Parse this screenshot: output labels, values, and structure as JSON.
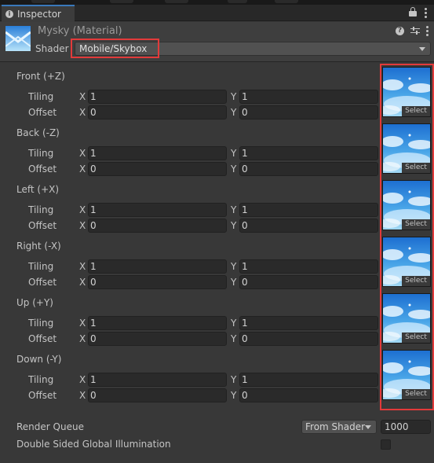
{
  "tab": {
    "label": "Inspector"
  },
  "material": {
    "title": "Mysky (Material)",
    "shader_label": "Shader",
    "shader_value": "Mobile/Skybox"
  },
  "labels": {
    "tiling": "Tiling",
    "offset": "Offset",
    "x": "X",
    "y": "Y",
    "select": "Select"
  },
  "slots": [
    {
      "title": "Front (+Z)",
      "tiling_x": "1",
      "tiling_y": "1",
      "offset_x": "0",
      "offset_y": "0"
    },
    {
      "title": "Back (-Z)",
      "tiling_x": "1",
      "tiling_y": "1",
      "offset_x": "0",
      "offset_y": "0"
    },
    {
      "title": "Left (+X)",
      "tiling_x": "1",
      "tiling_y": "1",
      "offset_x": "0",
      "offset_y": "0"
    },
    {
      "title": "Right (-X)",
      "tiling_x": "1",
      "tiling_y": "1",
      "offset_x": "0",
      "offset_y": "0"
    },
    {
      "title": "Up (+Y)",
      "tiling_x": "1",
      "tiling_y": "1",
      "offset_x": "0",
      "offset_y": "0"
    },
    {
      "title": "Down (-Y)",
      "tiling_x": "1",
      "tiling_y": "1",
      "offset_x": "0",
      "offset_y": "0"
    }
  ],
  "render_queue": {
    "label": "Render Queue",
    "mode": "From Shader",
    "value": "1000"
  },
  "dsgi": {
    "label": "Double Sided Global Illumination",
    "checked": false
  },
  "colors": {
    "accent_tab": "#3a79bb",
    "highlight": "#e23a3a",
    "sky_top": "#1d6fd1",
    "sky_bottom": "#a9dcf5"
  },
  "icons": [
    "info-icon",
    "lock-icon",
    "kebab-menu-icon",
    "help-icon",
    "sliders-icon",
    "material-icon"
  ]
}
